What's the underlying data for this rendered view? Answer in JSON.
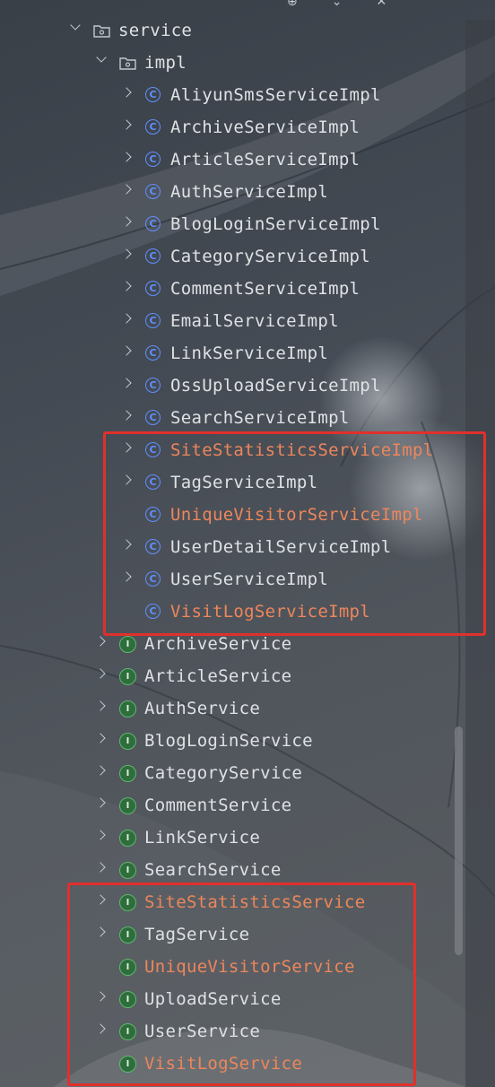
{
  "colors": {
    "highlight_text": "#ed865b",
    "normal_text": "#dfe1e5",
    "class_icon": "#5e90ff",
    "interface_icon": "#5fb76f",
    "annotation_box": "#e0302c"
  },
  "icons": {
    "folder": "package-folder-icon",
    "class": "class-c-icon",
    "interface": "interface-i-icon"
  },
  "tree": {
    "service_folder": "service",
    "impl_folder": "impl",
    "impl_items": [
      {
        "label": "AliyunSmsServiceImpl"
      },
      {
        "label": "ArchiveServiceImpl"
      },
      {
        "label": "ArticleServiceImpl"
      },
      {
        "label": "AuthServiceImpl"
      },
      {
        "label": "BlogLoginServiceImpl"
      },
      {
        "label": "CategoryServiceImpl"
      },
      {
        "label": "CommentServiceImpl"
      },
      {
        "label": "EmailServiceImpl"
      },
      {
        "label": "LinkServiceImpl"
      },
      {
        "label": "OssUploadServiceImpl"
      },
      {
        "label": "SearchServiceImpl"
      },
      {
        "label": "SiteStatisticsServiceImpl"
      },
      {
        "label": "TagServiceImpl"
      },
      {
        "label": "UniqueVisitorServiceImpl"
      },
      {
        "label": "UserDetailServiceImpl"
      },
      {
        "label": "UserServiceImpl"
      },
      {
        "label": "VisitLogServiceImpl"
      }
    ],
    "service_items": [
      {
        "label": "ArchiveService"
      },
      {
        "label": "ArticleService"
      },
      {
        "label": "AuthService"
      },
      {
        "label": "BlogLoginService"
      },
      {
        "label": "CategoryService"
      },
      {
        "label": "CommentService"
      },
      {
        "label": "LinkService"
      },
      {
        "label": "SearchService"
      },
      {
        "label": "SiteStatisticsService"
      },
      {
        "label": "TagService"
      },
      {
        "label": "UniqueVisitorService"
      },
      {
        "label": "UploadService"
      },
      {
        "label": "UserService"
      },
      {
        "label": "VisitLogService"
      }
    ]
  },
  "toolbar_icons": [
    "settings-icon",
    "collapse-icon",
    "close-icon"
  ]
}
